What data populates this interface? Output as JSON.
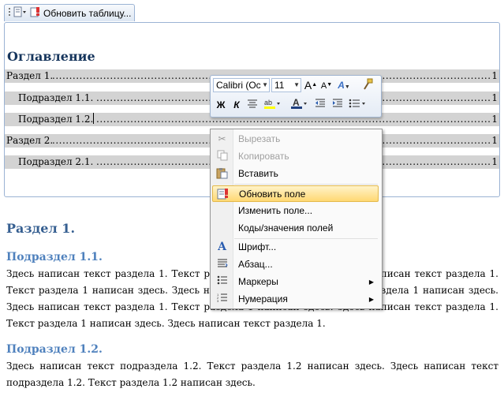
{
  "toc_tab": {
    "label": "Обновить таблицу..."
  },
  "toc": {
    "title": "Оглавление",
    "lines": [
      {
        "text": "Раздел 1.",
        "page": "1"
      },
      {
        "text": "Подраздел 1.1.",
        "page": "1"
      },
      {
        "text": "Подраздел 1.2.",
        "page": "1"
      },
      {
        "text": "Раздел 2.",
        "page": "1"
      },
      {
        "text": "Подраздел 2.1.",
        "page": "1"
      }
    ]
  },
  "document": {
    "h1": "Раздел 1.",
    "sub1": {
      "title": "Подраздел 1.1.",
      "lines": [
        "Здесь написан текст раздела 1. Текст раздела 1 написан здесь. Здесь написан текст раздела 1.",
        "Текст раздела 1 написан здесь. Здесь написан текст раздела 1. Текст раздела 1 написан здесь.",
        "Здесь написан текст раздела 1. Текст раздела 1 написан здесь. Здесь написан текст раздела 1.",
        "Текст раздела 1 написан здесь. Здесь написан текст раздела 1."
      ]
    },
    "sub2": {
      "title": "Подраздел 1.2.",
      "lines": [
        "Здесь написан текст подраздела 1.2. Текст раздела 1.2 написан здесь. Здесь написан текст",
        "подраздела 1.2. Текст раздела 1.2 написан здесь."
      ]
    }
  },
  "mini_toolbar": {
    "font_name": "Calibri (Ос",
    "font_size": "11",
    "bold": "Ж",
    "italic": "К",
    "grow_font": "A",
    "shrink_font": "A",
    "font_color_letter": "A",
    "styles_letter": "A"
  },
  "context_menu": {
    "items": [
      {
        "label": "Вырезать",
        "icon": "scissors-icon"
      },
      {
        "label": "Копировать",
        "icon": "copy-icon"
      },
      {
        "label": "Вставить",
        "icon": "paste-icon"
      },
      {
        "label": "Обновить поле",
        "icon": "update-field-icon"
      },
      {
        "label": "Изменить поле...",
        "icon": ""
      },
      {
        "label": "Коды/значения полей",
        "icon": ""
      },
      {
        "label": "Шрифт...",
        "icon": "font-icon"
      },
      {
        "label": "Абзац...",
        "icon": "paragraph-icon"
      },
      {
        "label": "Маркеры",
        "icon": "bullets-icon"
      },
      {
        "label": "Нумерация",
        "icon": "numbering-icon"
      }
    ],
    "font_icon_letter": "A"
  },
  "colors": {
    "heading": "#365f91",
    "subheading": "#4f81bd",
    "highlight": "#ffd873",
    "field_shading": "#d3d3d3"
  }
}
